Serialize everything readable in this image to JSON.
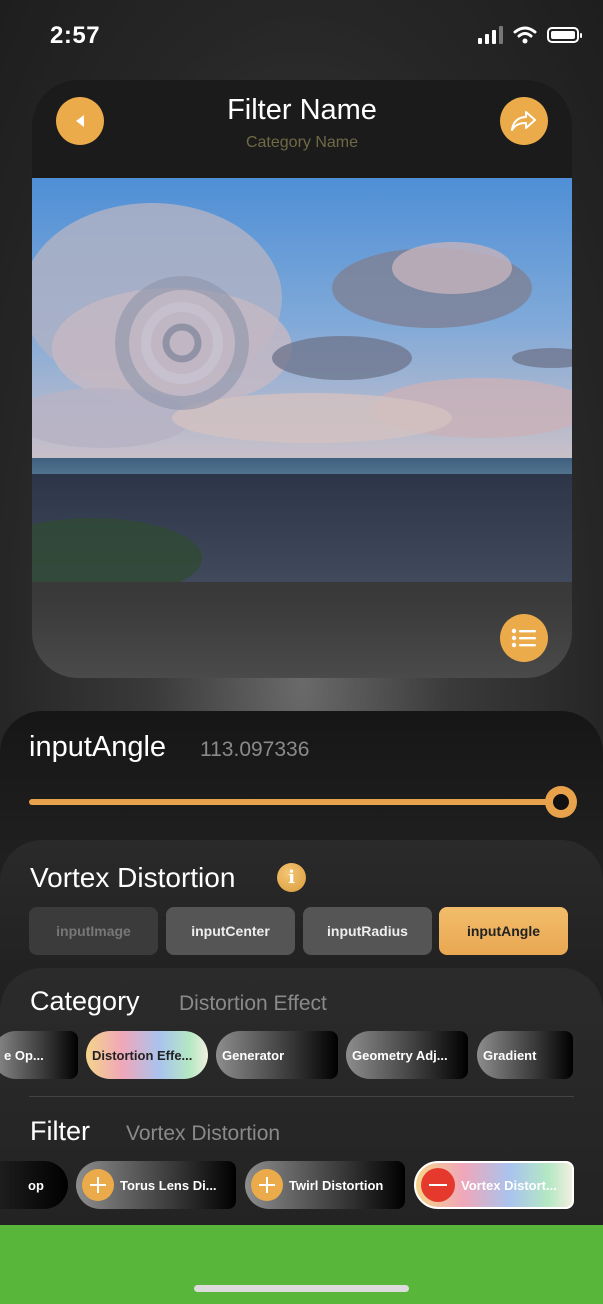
{
  "status_bar": {
    "time": "2:57"
  },
  "header": {
    "title": "Filter Name",
    "subtitle": "Category Name",
    "back_icon": "back-triangle-icon",
    "share_icon": "share-arrow-icon",
    "list_icon": "list-icon"
  },
  "parameter": {
    "name": "inputAngle",
    "value": "113.097336",
    "slider_fraction": 1.0
  },
  "filter_info": {
    "title": "Vortex Distortion",
    "info_icon": "i",
    "inputs": [
      "inputImage",
      "inputCenter",
      "inputRadius",
      "inputAngle"
    ],
    "selected_input": "inputAngle"
  },
  "category": {
    "label": "Category",
    "value": "Distortion Effect",
    "chips": [
      "e Op...",
      "Distortion Effe...",
      "Generator",
      "Geometry Adj...",
      "Gradient"
    ]
  },
  "filter": {
    "label": "Filter",
    "value": "Vortex Distortion",
    "chips": [
      "op",
      "Torus Lens Di...",
      "Twirl Distortion",
      "Vortex Distort..."
    ]
  },
  "colors": {
    "accent": "#ecab4a",
    "remove": "#e5392e",
    "bottom_bar": "#58b73a"
  }
}
